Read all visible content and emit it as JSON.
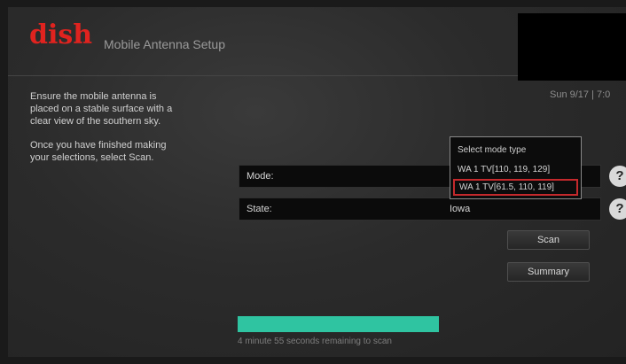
{
  "header": {
    "brand": "dish",
    "title": "Mobile Antenna Setup"
  },
  "datetime": "Sun 9/17 | 7:0",
  "instructions": {
    "line1": "Ensure the mobile antenna is",
    "line2": "placed on a stable surface with a",
    "line3": "clear view of the southern sky.",
    "line4": "Once you have finished making",
    "line5": "your selections, select Scan."
  },
  "mode": {
    "label": "Mode:",
    "help": "?"
  },
  "state": {
    "label": "State:",
    "value": "Iowa",
    "help": "?"
  },
  "dropdown": {
    "title": "Select mode type",
    "options": [
      "WA 1 TV[110, 119, 129]",
      "WA 1 TV[61.5, 110, 119]"
    ],
    "selected_index": 1
  },
  "buttons": {
    "scan": "Scan",
    "summary": "Summary"
  },
  "progress": {
    "fraction": 1.0,
    "text": "4 minute 55 seconds remaining to scan"
  },
  "colors": {
    "brand_red": "#e0231f",
    "progress": "#2fc4a1",
    "selection_border": "#c4292c"
  }
}
